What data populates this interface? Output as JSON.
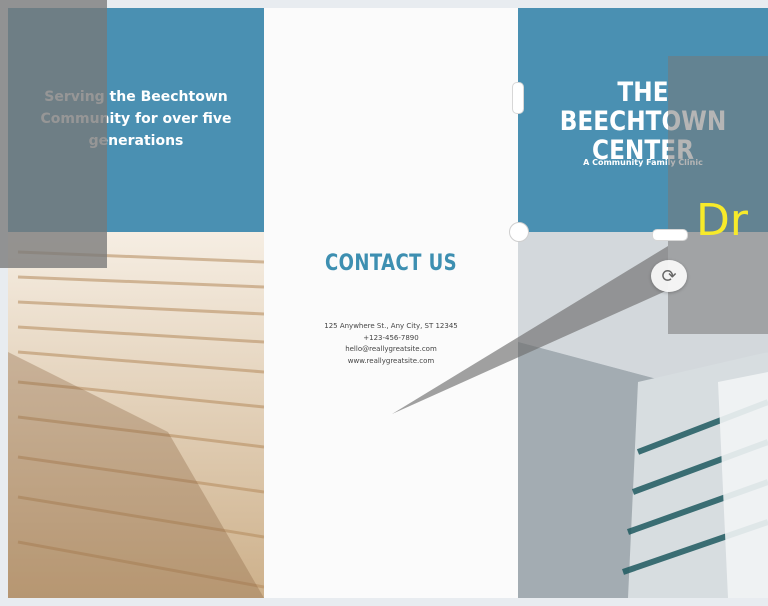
{
  "brochure": {
    "left_panel": {
      "tagline_lines": [
        "Serving the Beechtown",
        "Community for over five",
        "generations"
      ]
    },
    "middle_panel": {
      "title": "CONTACT US",
      "contact_lines": [
        "125 Anywhere St., Any City, ST 12345",
        "+123-456-7890",
        "hello@reallygreatsite.com",
        "www.reallygreatsite.com"
      ]
    },
    "right_panel": {
      "title_line1": "THE BEECHTOWN",
      "title_line2": "CENTER",
      "subtitle": "A Community Family Clinic"
    }
  },
  "overlay": {
    "drag_hint": "Dr"
  },
  "icons": {
    "rotate": "rotate-icon"
  },
  "colors": {
    "accent_blue": "#4a90b2",
    "title_blue": "#3d8fb1",
    "hint_yellow": "#f7ea2a"
  }
}
